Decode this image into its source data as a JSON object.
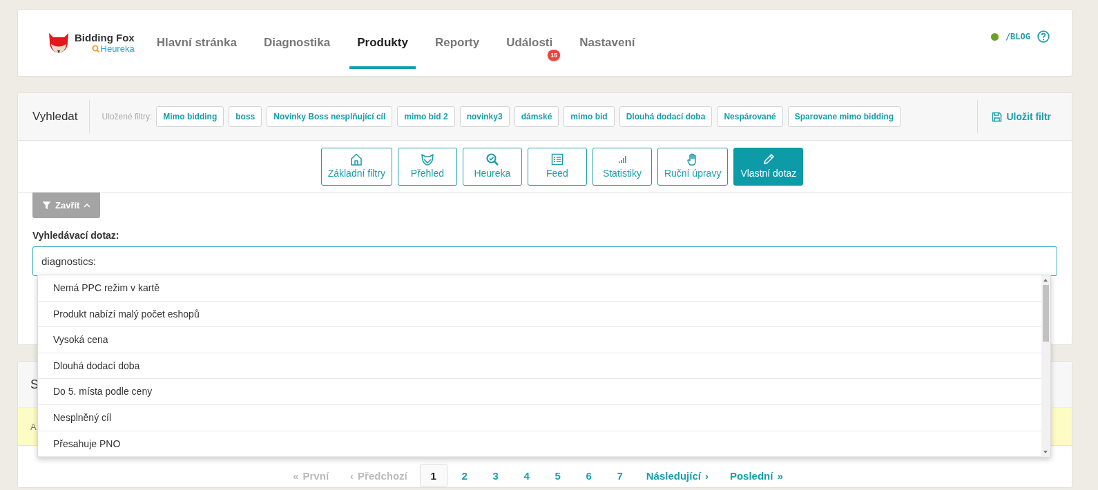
{
  "logo": {
    "name": "Bidding Fox",
    "sub": "Heureka"
  },
  "nav": [
    {
      "label": "Hlavní stránka",
      "selected": false
    },
    {
      "label": "Diagnostika",
      "selected": false
    },
    {
      "label": "Produkty",
      "selected": true
    },
    {
      "label": "Reporty",
      "selected": false
    },
    {
      "label": "Události",
      "selected": false,
      "badge": "15"
    },
    {
      "label": "Nastavení",
      "selected": false
    }
  ],
  "account": {
    "link": "/BLOG"
  },
  "search": {
    "title": "Vyhledat",
    "saved_label": "Uložené filtry:",
    "save_button": "Uložit filtr",
    "saved_filters": [
      "Mimo bidding",
      "boss",
      "Novinky Boss nesplňující cíl",
      "mimo bid 2",
      "novinky3",
      "dámské",
      "mimo bid",
      "Dlouhá dodací doba",
      "Nespárované",
      "Sparovane mimo bidding"
    ]
  },
  "modes": [
    {
      "label": "Základní filtry",
      "kind": "home",
      "selected": false
    },
    {
      "label": "Přehled",
      "kind": "fox",
      "selected": false
    },
    {
      "label": "Heureka",
      "kind": "search",
      "selected": false
    },
    {
      "label": "Feed",
      "kind": "list",
      "selected": false
    },
    {
      "label": "Statistiky",
      "kind": "signal",
      "selected": false
    },
    {
      "label": "Ruční úpravy",
      "kind": "hand",
      "selected": false
    },
    {
      "label": "Vlastní dotaz",
      "kind": "pencil",
      "selected": true
    }
  ],
  "toggle": "Zavřít",
  "query": {
    "label": "Vyhledávací dotaz:",
    "value": "diagnostics:"
  },
  "suggestions": [
    "Nemá PPC režim v kartě",
    "Produkt nabízí malý počet eshopů",
    "Vysoká cena",
    "Dlouhá dodací doba",
    "Do 5. místa podle ceny",
    "Nesplněný cíl",
    "Přesahuje PNO"
  ],
  "products": {
    "title": "S",
    "filters_label": "A"
  },
  "pagination": {
    "first": {
      "icon": "«",
      "label": "První",
      "disabled": true
    },
    "prev": {
      "icon": "‹",
      "label": "Předchozí",
      "disabled": true
    },
    "pages": [
      {
        "label": "1",
        "selected": true
      },
      {
        "label": "2",
        "selected": false
      },
      {
        "label": "3",
        "selected": false
      },
      {
        "label": "4",
        "selected": false
      },
      {
        "label": "5",
        "selected": false
      },
      {
        "label": "6",
        "selected": false
      },
      {
        "label": "7",
        "selected": false
      }
    ],
    "next": {
      "icon": "›",
      "label": "Následující",
      "disabled": false
    },
    "last": {
      "icon": "»",
      "label": "Poslední",
      "disabled": false
    }
  }
}
